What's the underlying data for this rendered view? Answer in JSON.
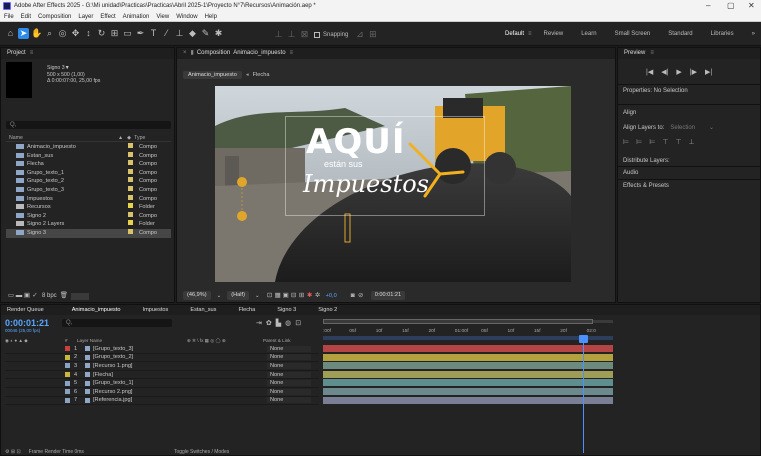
{
  "window": {
    "title": "Adobe After Effects 2025 - G:\\Mi unidad\\Practicas\\Practicas\\Abril 2025-1\\Proyecto N°7\\Recursos\\Animación.aep *",
    "minimize": "–",
    "maximize": "▢",
    "close": "✕"
  },
  "menu": [
    "File",
    "Edit",
    "Composition",
    "Layer",
    "Effect",
    "Animation",
    "View",
    "Window",
    "Help"
  ],
  "toolbar": {
    "snapping": "Snapping",
    "workspaces": [
      "Default",
      "Review",
      "Learn",
      "Small Screen",
      "Standard",
      "Libraries"
    ],
    "more": "»"
  },
  "project": {
    "tab": "Project",
    "menu_icon": "≡",
    "selected_name": "Signo 3▼",
    "selected_size": "500 x 500 (1,00)",
    "selected_duration": "Δ 0:00:07:00, 25,00 fps",
    "search_placeholder": "Q,",
    "col_name": "Name",
    "col_type": "Type",
    "items": [
      {
        "name": "Animacio_impuesto",
        "type": "Compo",
        "label": "#d9c36a",
        "kind": "comp"
      },
      {
        "name": "Estan_sus",
        "type": "Compo",
        "label": "#d9c36a",
        "kind": "comp"
      },
      {
        "name": "Flecha",
        "type": "Compo",
        "label": "#d9c36a",
        "kind": "comp"
      },
      {
        "name": "Grupo_texto_1",
        "type": "Compo",
        "label": "#d9c36a",
        "kind": "comp"
      },
      {
        "name": "Grupo_texto_2",
        "type": "Compo",
        "label": "#d9c36a",
        "kind": "comp"
      },
      {
        "name": "Grupo_texto_3",
        "type": "Compo",
        "label": "#d9c36a",
        "kind": "comp"
      },
      {
        "name": "Impuestos",
        "type": "Compo",
        "label": "#d9c36a",
        "kind": "comp"
      },
      {
        "name": "Recursos",
        "type": "Folder",
        "label": "#e9d34a",
        "kind": "folder"
      },
      {
        "name": "Signo 2",
        "type": "Compo",
        "label": "#d9c36a",
        "kind": "comp"
      },
      {
        "name": "Signo 2 Layers",
        "type": "Folder",
        "label": "#e9d34a",
        "kind": "folder"
      },
      {
        "name": "Signo 3",
        "type": "Compo",
        "label": "#d9c36a",
        "kind": "comp",
        "selected": true
      }
    ],
    "bpc": "8 bpc"
  },
  "comp": {
    "tab_prefix": "Composition",
    "tab": "Animacio_impuesto",
    "breadcrumb": [
      "Animacio_impuesto",
      "Flecha"
    ],
    "zoom": "(46,9%)",
    "resolution": "(Half)",
    "exposure": "+0,0",
    "timecode": "0:00:01:21",
    "artwork": {
      "headline": "AQUÍ",
      "sub": "están sus",
      "script": "Impuestos",
      "headline_color": "#ffffff",
      "accent": "#f2b01e"
    }
  },
  "right": {
    "preview": "Preview",
    "properties": "Properties: No Selection",
    "align": "Align",
    "align_to_label": "Align Layers to:",
    "align_to_value": "Selection",
    "distribute": "Distribute Layers:",
    "audio": "Audio",
    "effects": "Effects & Presets"
  },
  "timeline": {
    "tabs": [
      "Render Queue",
      "Animacio_impuesto",
      "Impuestos",
      "Estan_sus",
      "Flecha",
      "Signo 3",
      "Signo 2"
    ],
    "timecode": "0:00:01:21",
    "frames": "00046 (25,00 fps)",
    "search_placeholder": "Q,",
    "col_num": "#",
    "col_layer": "Layer Name",
    "col_parent": "Parent & Link",
    "ruler": [
      ":00f",
      "05f",
      "10f",
      "15f",
      "20f",
      "01:00f",
      "05f",
      "10f",
      "15f",
      "20f",
      "02:0"
    ],
    "layers": [
      {
        "num": "1",
        "name": "[Grupo_texto_3]",
        "label": "#c74141",
        "parent": "None",
        "bar": "#b54545"
      },
      {
        "num": "2",
        "name": "[Grupo_texto_2]",
        "label": "#c9b540",
        "parent": "None",
        "bar": "#b3a13e"
      },
      {
        "num": "3",
        "name": "[Recurso 1.png]",
        "label": "#8aa3c2",
        "parent": "None",
        "bar": "#6c8a7e"
      },
      {
        "num": "4",
        "name": "[Flecha]",
        "label": "#c9b540",
        "parent": "None",
        "bar": "#9f9d56"
      },
      {
        "num": "5",
        "name": "[Grupo_texto_1]",
        "label": "#8aa3c2",
        "parent": "None",
        "bar": "#5e8f8e"
      },
      {
        "num": "6",
        "name": "[Recurso 2.png]",
        "label": "#8aa3c2",
        "parent": "None",
        "bar": "#6c8a8e"
      },
      {
        "num": "7",
        "name": "[Referencia.jpg]",
        "label": "#8aa3c2",
        "parent": "None",
        "bar": "#7a7f96"
      }
    ],
    "status": "Frame Render Time 0ms",
    "footer": "Toggle Switches / Modes"
  }
}
